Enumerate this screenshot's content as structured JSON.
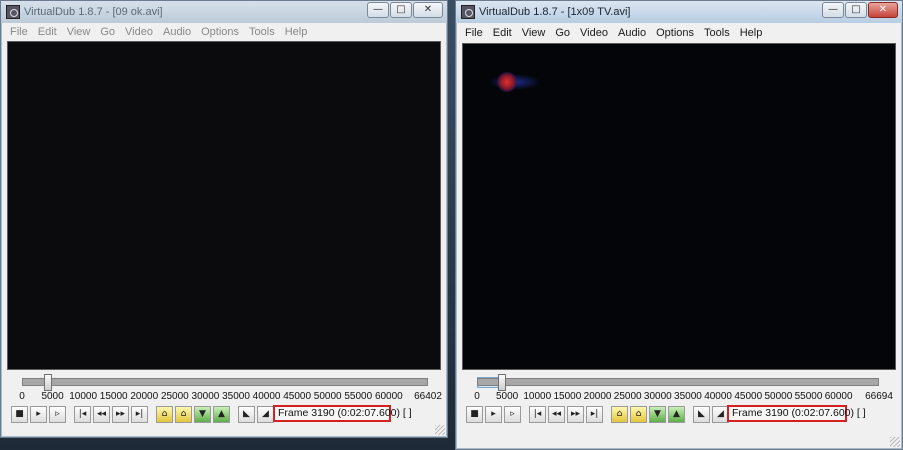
{
  "windows": [
    {
      "title": "VirtualDub 1.8.7 - [09 ok.avi]",
      "menu": [
        "File",
        "Edit",
        "View",
        "Go",
        "Video",
        "Audio",
        "Options",
        "Tools",
        "Help"
      ],
      "ticks": [
        "0",
        "5000",
        "10000",
        "15000",
        "20000",
        "25000",
        "30000",
        "35000",
        "40000",
        "45000",
        "50000",
        "55000",
        "60000",
        "66402"
      ],
      "frame_status": "Frame 3190 (0:02:07.600) [ ]",
      "position": 3190,
      "total": 66402
    },
    {
      "title": "VirtualDub 1.8.7 - [1x09 TV.avi]",
      "menu": [
        "File",
        "Edit",
        "View",
        "Go",
        "Video",
        "Audio",
        "Options",
        "Tools",
        "Help"
      ],
      "ticks": [
        "0",
        "5000",
        "10000",
        "15000",
        "20000",
        "25000",
        "30000",
        "35000",
        "40000",
        "45000",
        "50000",
        "55000",
        "60000",
        "66694"
      ],
      "frame_status": "Frame 3190 (0:02:07.600) [ ]",
      "position": 3190,
      "total": 66694
    }
  ],
  "caption_icons": {
    "minimize": "—",
    "maximize": "□",
    "close": "✕"
  },
  "toolbar_icons": [
    "stop-icon",
    "play-input-icon",
    "play-output-icon",
    "go-start-icon",
    "prev-frame-icon",
    "next-frame-icon",
    "go-end-icon",
    "prev-keyframe-icon",
    "next-keyframe-icon",
    "prev-scene-icon",
    "next-scene-icon",
    "mark-in-icon",
    "mark-out-icon"
  ],
  "toolbar_glyphs": [
    "■",
    "▸",
    "▹",
    "|◂",
    "◂◂",
    "▸▸",
    "▸|",
    "⌂",
    "⌂",
    "▼",
    "▲",
    "◣",
    "◢"
  ]
}
